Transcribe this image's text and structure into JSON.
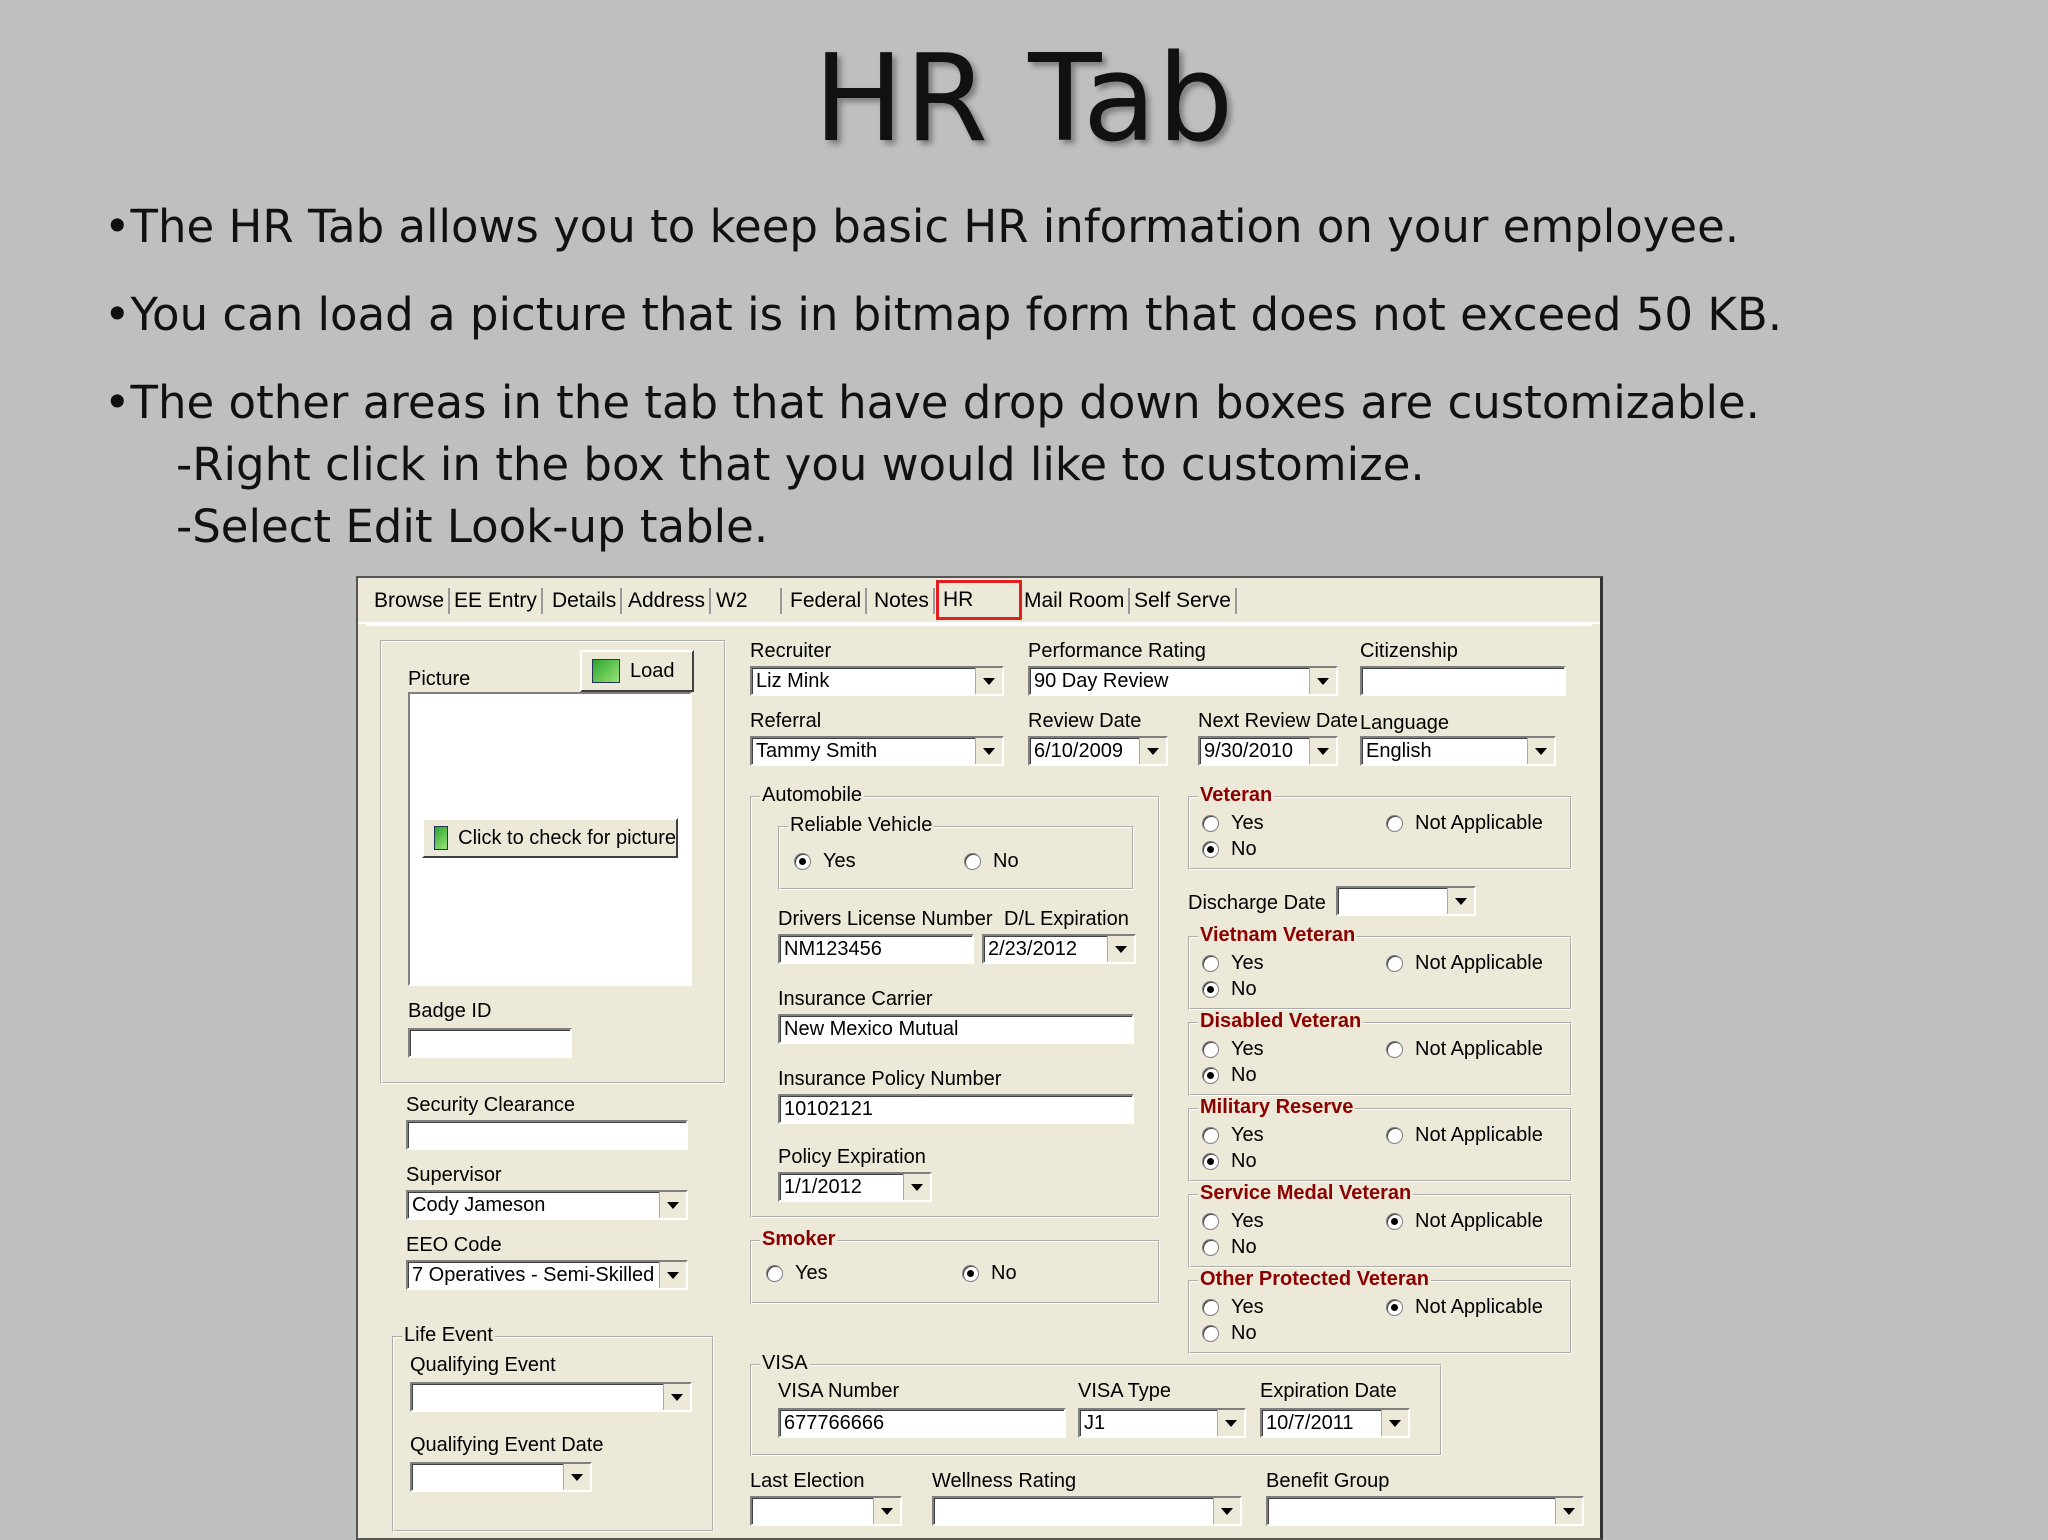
{
  "slide": {
    "title": "HR Tab",
    "bullets": [
      "•The HR Tab allows you to keep basic HR information on your employee.",
      "•You can load a picture that is in bitmap form that does not exceed 50 KB.",
      "•The other areas in the tab that have drop down boxes are customizable."
    ],
    "sub_bullets": [
      "-Right click in the box that you would like to customize.",
      "-Select Edit Look-up table."
    ]
  },
  "tabs": [
    "Browse",
    "EE Entry",
    "Details",
    "Address",
    "W2",
    "Federal",
    "Notes",
    "HR",
    "Mail Room",
    "Self Serve"
  ],
  "active_tab": "HR",
  "picture": {
    "label": "Picture",
    "load_button": "Load",
    "check_button": "Click to check for picture",
    "badge_label": "Badge ID",
    "badge_value": ""
  },
  "left": {
    "security_label": "Security Clearance",
    "security_value": "",
    "supervisor_label": "Supervisor",
    "supervisor_value": "Cody Jameson",
    "eeo_label": "EEO Code",
    "eeo_value": "7 Operatives - Semi-Skilled",
    "life_event_title": "Life Event",
    "qualifying_event_label": "Qualifying Event",
    "qualifying_event_value": "",
    "qualifying_date_label": "Qualifying Event Date",
    "qualifying_date_value": ""
  },
  "middle": {
    "recruiter_label": "Recruiter",
    "recruiter_value": "Liz Mink",
    "referral_label": "Referral",
    "referral_value": "Tammy Smith",
    "automobile_title": "Automobile",
    "reliable_title": "Reliable Vehicle",
    "yes": "Yes",
    "no": "No",
    "dl_label": "Drivers License Number",
    "dl_value": "NM123456",
    "dlexp_label": "D/L Expiration",
    "dlexp_value": "2/23/2012",
    "carrier_label": "Insurance Carrier",
    "carrier_value": "New Mexico Mutual",
    "policy_label": "Insurance Policy Number",
    "policy_value": "10102121",
    "policyexp_label": "Policy Expiration",
    "policyexp_value": "1/1/2012",
    "smoker_title": "Smoker"
  },
  "perf": {
    "rating_label": "Performance Rating",
    "rating_value": "90 Day Review",
    "review_label": "Review Date",
    "review_value": "6/10/2009",
    "next_label": "Next Review Date",
    "next_value": "9/30/2010"
  },
  "right": {
    "citizenship_label": "Citizenship",
    "citizenship_value": "",
    "language_label": "Language",
    "language_value": "English",
    "discharge_label": "Discharge Date",
    "discharge_value": "",
    "not_applicable": "Not Applicable",
    "veteran_groups": [
      "Veteran",
      "Vietnam Veteran",
      "Disabled Veteran",
      "Military Reserve",
      "Service Medal Veteran",
      "Other Protected Veteran"
    ]
  },
  "visa": {
    "title": "VISA",
    "number_label": "VISA Number",
    "number_value": "677766666",
    "type_label": "VISA Type",
    "type_value": "J1",
    "exp_label": "Expiration Date",
    "exp_value": "10/7/2011"
  },
  "bottom": {
    "last_election_label": "Last Election",
    "wellness_label": "Wellness Rating",
    "benefit_label": "Benefit Group"
  }
}
